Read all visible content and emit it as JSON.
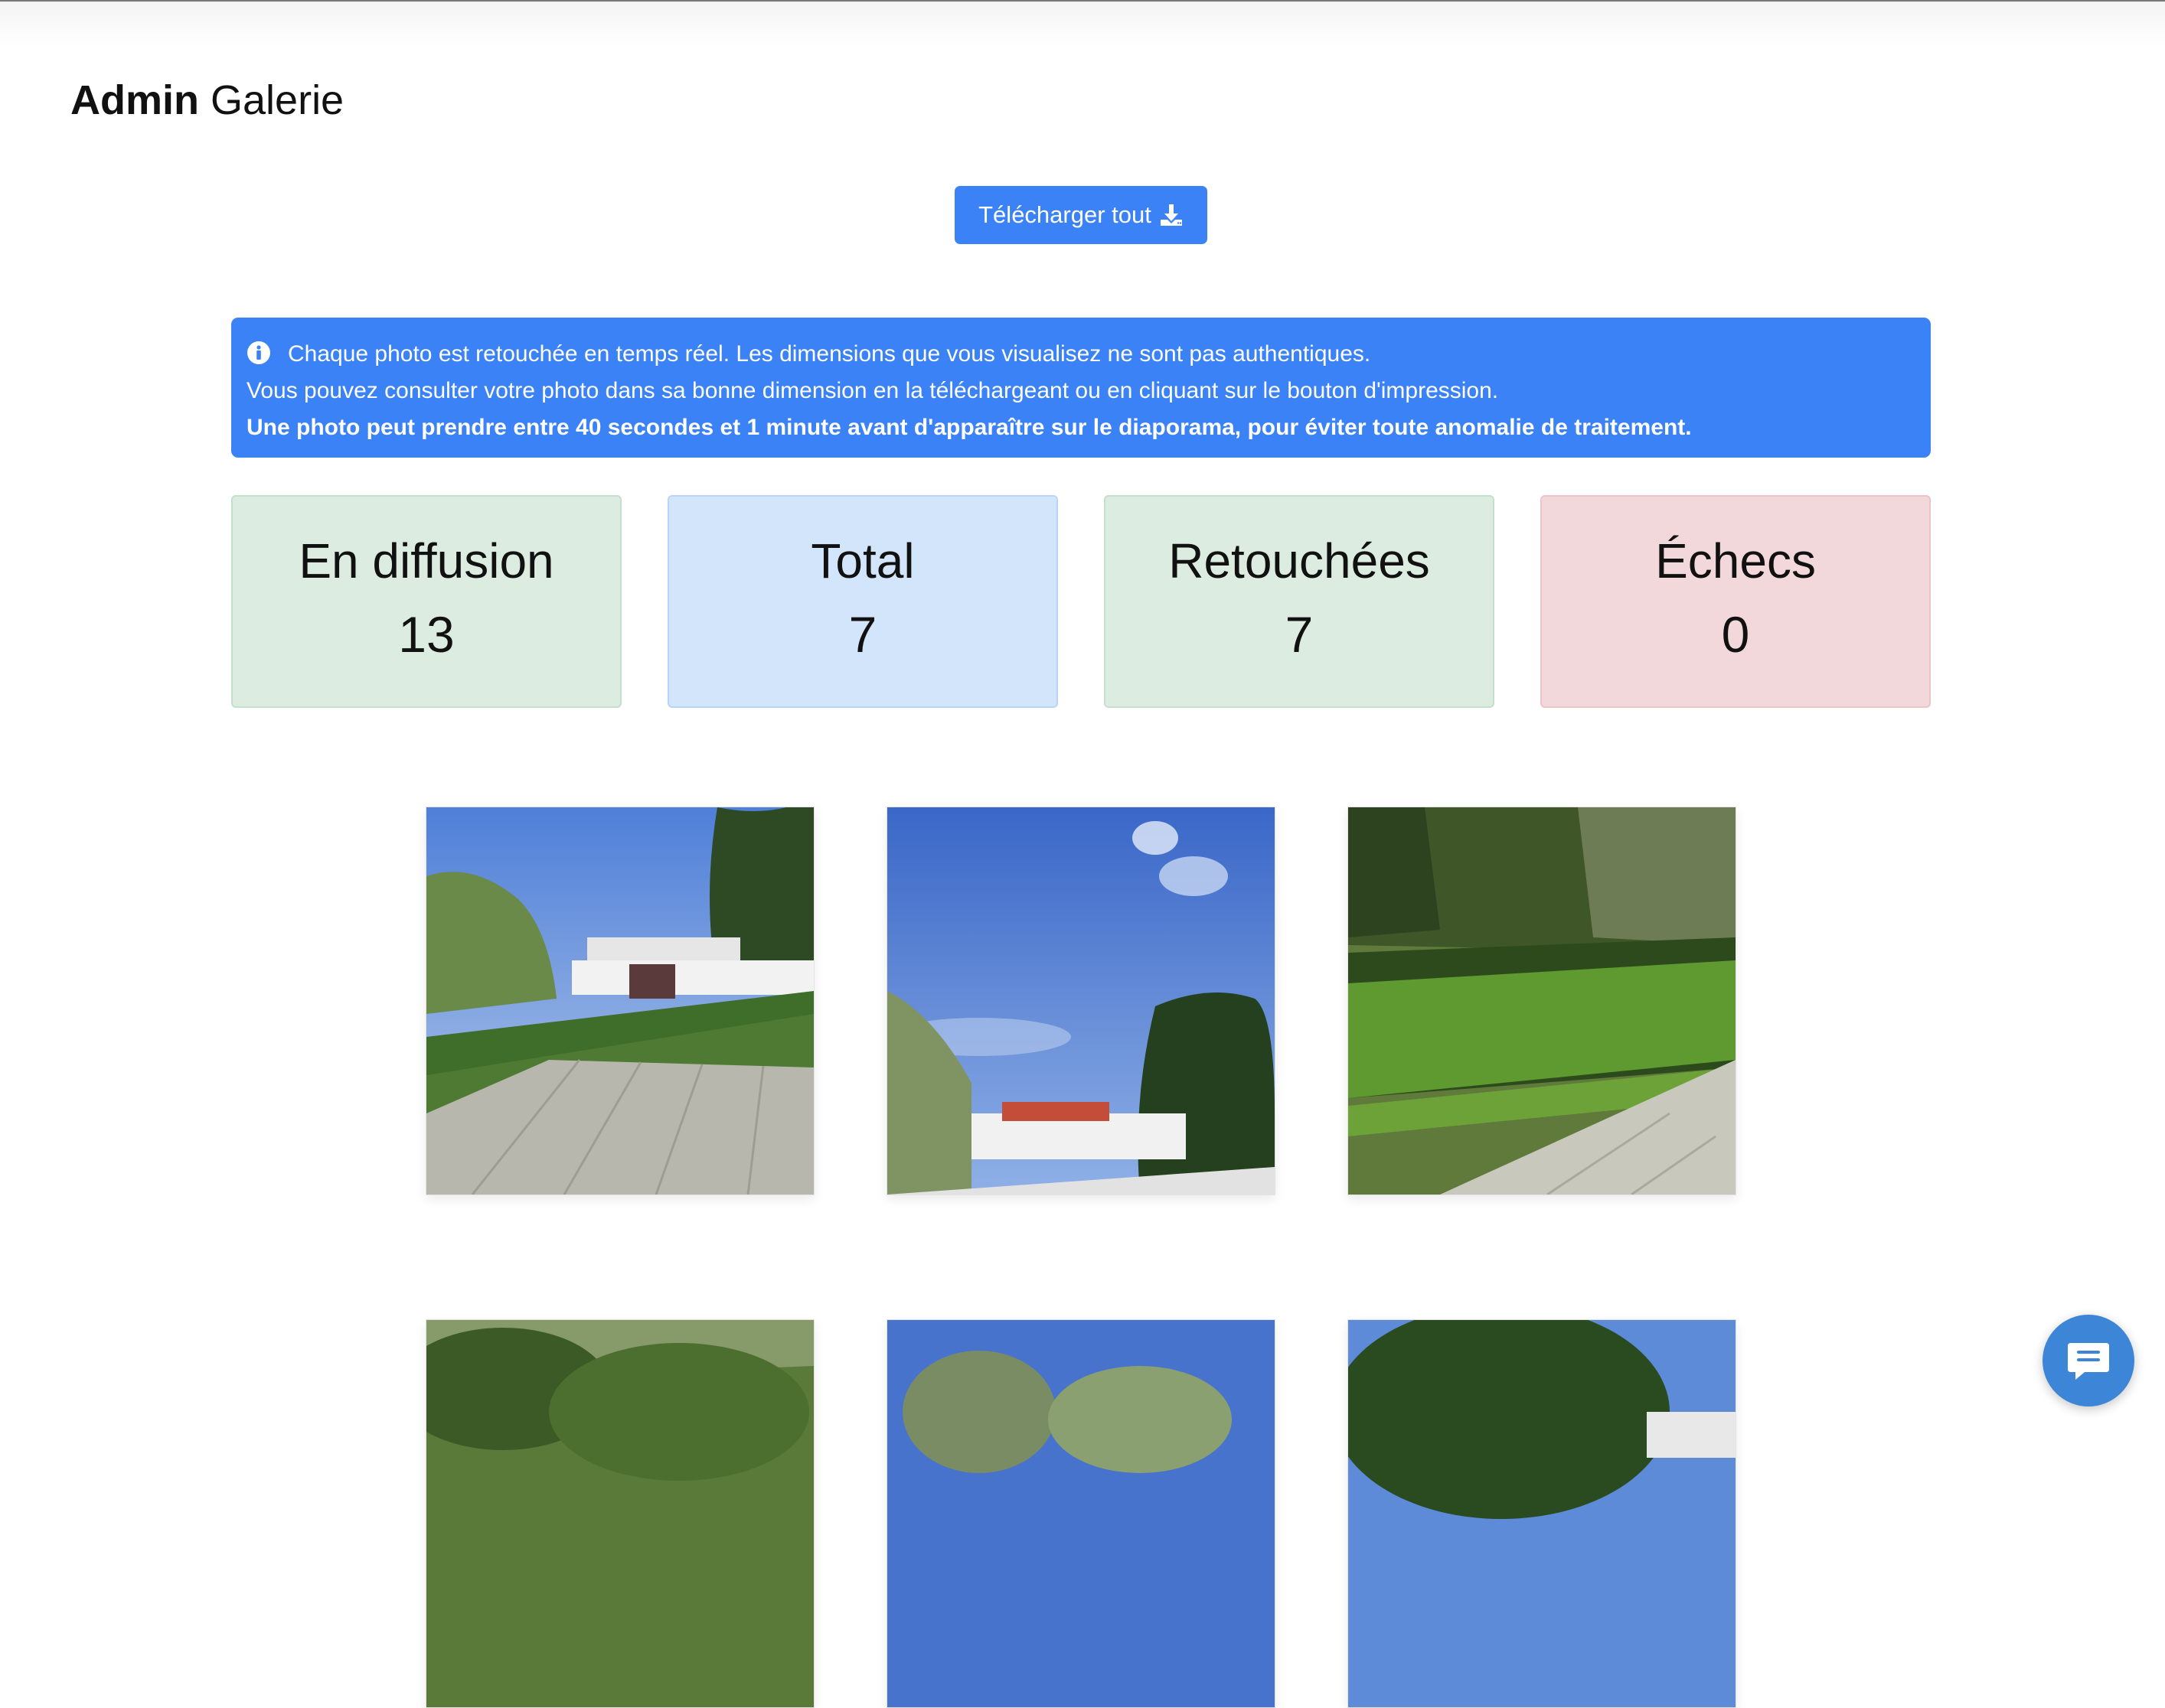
{
  "header": {
    "brand_bold": "Admin",
    "brand_regular": "Galerie"
  },
  "toolbar": {
    "download_all_label": "Télécharger tout",
    "download_icon": "download-icon"
  },
  "alert": {
    "icon": "info-circle-icon",
    "line1": "Chaque photo est retouchée en temps réel. Les dimensions que vous visualisez ne sont pas authentiques.",
    "line2": "Vous pouvez consulter votre photo dans sa bonne dimension en la téléchargeant ou en cliquant sur le bouton d'impression.",
    "line3": "Une photo peut prendre entre 40 secondes et 1 minute avant d'apparaître sur le diaporama, pour éviter toute anomalie de traitement.",
    "color": "#3b82f6"
  },
  "stats": [
    {
      "label": "En diffusion",
      "value": "13",
      "color": "#dcece0"
    },
    {
      "label": "Total",
      "value": "7",
      "color": "#d3e5fb"
    },
    {
      "label": "Retouchées",
      "value": "7",
      "color": "#dcece0"
    },
    {
      "label": "Échecs",
      "value": "0",
      "color": "#f3d8db"
    }
  ],
  "gallery": {
    "photos": [
      {
        "subject": "garden-terrace-with-trampoline"
      },
      {
        "subject": "blue-sky-with-trees"
      },
      {
        "subject": "lawn-with-shrubs"
      },
      {
        "subject": "shrubs-and-swing"
      },
      {
        "subject": "sky-over-trees"
      },
      {
        "subject": "conifer-tree"
      }
    ]
  },
  "chat": {
    "icon": "chat-bubble-icon"
  },
  "colors": {
    "accent": "#3b82f6",
    "chat": "#3d86d7"
  }
}
